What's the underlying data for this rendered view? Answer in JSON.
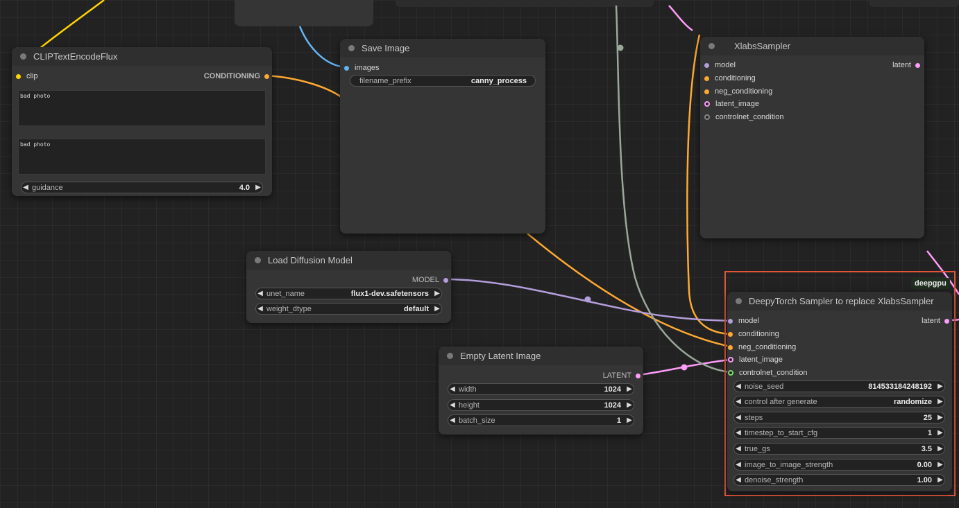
{
  "nodes": {
    "clip_text_encode": {
      "title": "CLIPTextEncodeFlux",
      "input_clip": "clip",
      "output_conditioning": "CONDITIONING",
      "text1": "bad photo",
      "text2": "bad photo",
      "guidance_label": "guidance",
      "guidance_value": "4.0"
    },
    "save_image": {
      "title": "Save Image",
      "input_images": "images",
      "filename_prefix_label": "filename_prefix",
      "filename_prefix_value": "canny_process"
    },
    "xlabs_sampler": {
      "title": "XlabsSampler",
      "inputs": [
        "model",
        "conditioning",
        "neg_conditioning",
        "latent_image",
        "controlnet_condition"
      ],
      "output_latent": "latent"
    },
    "load_diffusion_model": {
      "title": "Load Diffusion Model",
      "output_model": "MODEL",
      "unet_name_label": "unet_name",
      "unet_name_value": "flux1-dev.safetensors",
      "weight_dtype_label": "weight_dtype",
      "weight_dtype_value": "default"
    },
    "empty_latent": {
      "title": "Empty Latent Image",
      "output_latent": "LATENT",
      "widgets": [
        {
          "label": "width",
          "value": "1024"
        },
        {
          "label": "height",
          "value": "1024"
        },
        {
          "label": "batch_size",
          "value": "1"
        }
      ]
    },
    "deepy_sampler": {
      "badge": "deepgpu",
      "title": "DeepyTorch Sampler to replace XlabsSampler",
      "inputs": [
        "model",
        "conditioning",
        "neg_conditioning",
        "latent_image",
        "controlnet_condition"
      ],
      "output_latent": "latent",
      "widgets": [
        {
          "label": "noise_seed",
          "value": "814533184248192"
        },
        {
          "label": "control after generate",
          "value": "randomize"
        },
        {
          "label": "steps",
          "value": "25"
        },
        {
          "label": "timestep_to_start_cfg",
          "value": "1"
        },
        {
          "label": "true_gs",
          "value": "3.5"
        },
        {
          "label": "image_to_image_strength",
          "value": "0.00"
        },
        {
          "label": "denoise_strength",
          "value": "1.00"
        }
      ]
    }
  },
  "colors": {
    "clip": "#ffd500",
    "conditioning": "#ffa931",
    "image": "#64b5f6",
    "model": "#b39ddb",
    "latent": "#ff9cf9",
    "control": "#9aa89a",
    "highlight": "#e0553a"
  }
}
